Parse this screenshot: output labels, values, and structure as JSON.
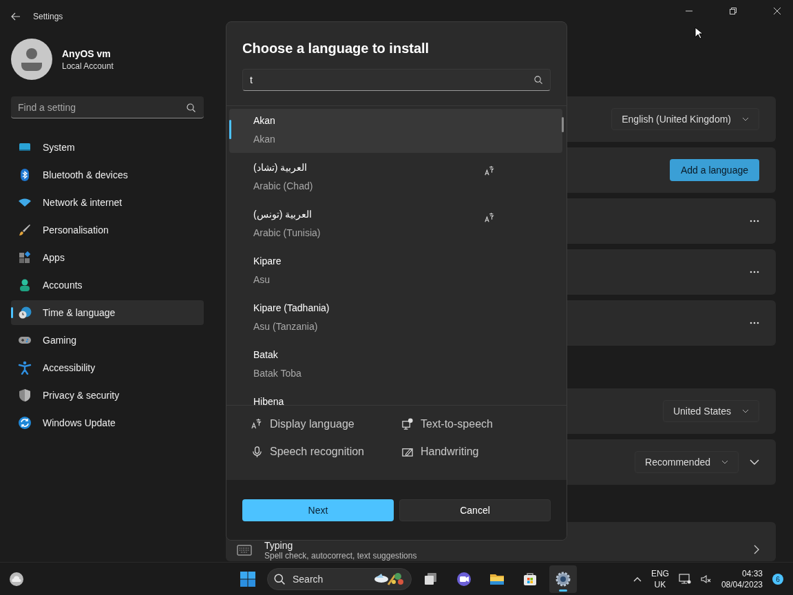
{
  "window": {
    "title": "Settings"
  },
  "account": {
    "name": "AnyOS vm",
    "type": "Local Account"
  },
  "sidebar": {
    "search": {
      "placeholder": "Find a setting"
    },
    "items": [
      {
        "label": "System",
        "kind": "system",
        "selected": false
      },
      {
        "label": "Bluetooth & devices",
        "kind": "bluetooth",
        "selected": false
      },
      {
        "label": "Network & internet",
        "kind": "network",
        "selected": false
      },
      {
        "label": "Personalisation",
        "kind": "brush",
        "selected": false
      },
      {
        "label": "Apps",
        "kind": "apps",
        "selected": false
      },
      {
        "label": "Accounts",
        "kind": "accounts",
        "selected": false
      },
      {
        "label": "Time & language",
        "kind": "time",
        "selected": true
      },
      {
        "label": "Gaming",
        "kind": "gaming",
        "selected": false
      },
      {
        "label": "Accessibility",
        "kind": "accessibility",
        "selected": false
      },
      {
        "label": "Privacy & security",
        "kind": "privacy",
        "selected": false
      },
      {
        "label": "Windows Update",
        "kind": "update",
        "selected": false
      }
    ]
  },
  "content": {
    "cards": [
      {
        "kind": "dropdown",
        "value": "English (United Kingdom)"
      },
      {
        "kind": "button",
        "label": "Add a language"
      },
      {
        "kind": "more"
      },
      {
        "kind": "more"
      },
      {
        "kind": "more"
      },
      {
        "kind": "gap"
      },
      {
        "kind": "dropdown",
        "value": "United States"
      },
      {
        "kind": "dropdown_expand",
        "value": "Recommended"
      },
      {
        "kind": "gap"
      },
      {
        "kind": "link",
        "title": "Typing",
        "subtitle": "Spell check, autocorrect, text suggestions"
      }
    ]
  },
  "dialog": {
    "title": "Choose a language to install",
    "search": {
      "value": "t"
    },
    "languages": [
      {
        "name": "Akan",
        "english": "Akan",
        "selected": true,
        "display_language": false
      },
      {
        "name": "العربية (تشاد)",
        "english": "Arabic (Chad)",
        "selected": false,
        "display_language": true
      },
      {
        "name": "العربية (تونس)",
        "english": "Arabic (Tunisia)",
        "selected": false,
        "display_language": true
      },
      {
        "name": "Kipare",
        "english": "Asu",
        "selected": false,
        "display_language": false
      },
      {
        "name": "Kipare (Tadhania)",
        "english": "Asu (Tanzania)",
        "selected": false,
        "display_language": false
      },
      {
        "name": "Batak",
        "english": "Batak Toba",
        "selected": false,
        "display_language": false
      },
      {
        "name": "Hibena",
        "selected": false,
        "display_language": false
      }
    ],
    "features": [
      {
        "label": "Display language",
        "kind": "display"
      },
      {
        "label": "Text-to-speech",
        "kind": "tts"
      },
      {
        "label": "Speech recognition",
        "kind": "speech"
      },
      {
        "label": "Handwriting",
        "kind": "handwriting"
      }
    ],
    "buttons": [
      {
        "label": "Next",
        "kind": "primary"
      },
      {
        "label": "Cancel",
        "kind": "secondary"
      }
    ]
  },
  "taskbar": {
    "search": {
      "placeholder": "Search"
    },
    "apps": [
      {
        "kind": "taskview",
        "selected": false
      },
      {
        "kind": "chat",
        "selected": false
      },
      {
        "kind": "explorer",
        "selected": false
      },
      {
        "kind": "store",
        "selected": false
      },
      {
        "kind": "settings",
        "selected": true
      }
    ],
    "language": {
      "code": "ENG",
      "region": "UK"
    },
    "time": "04:33",
    "date": "08/04/2023",
    "notifications": "6"
  }
}
